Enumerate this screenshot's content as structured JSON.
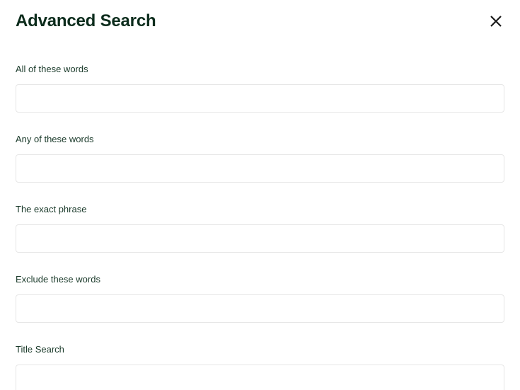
{
  "header": {
    "title": "Advanced Search"
  },
  "fields": {
    "all_words": {
      "label": "All of these words",
      "value": ""
    },
    "any_words": {
      "label": "Any of these words",
      "value": ""
    },
    "exact_phrase": {
      "label": "The exact phrase",
      "value": ""
    },
    "exclude_words": {
      "label": "Exclude these words",
      "value": ""
    },
    "title_search": {
      "label": "Title Search",
      "value": ""
    }
  }
}
